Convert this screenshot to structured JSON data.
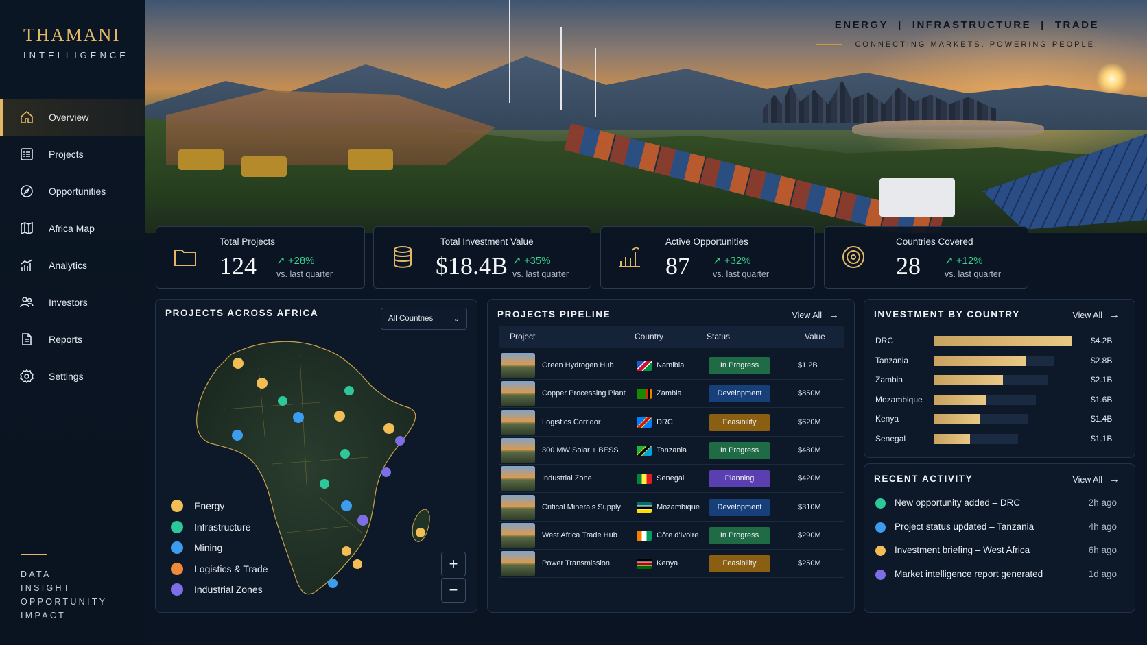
{
  "brand": {
    "name": "THAMANI",
    "sub": "INTELLIGENCE"
  },
  "nav": [
    {
      "label": "Overview",
      "icon": "home-icon"
    },
    {
      "label": "Projects",
      "icon": "list-icon"
    },
    {
      "label": "Opportunities",
      "icon": "compass-icon"
    },
    {
      "label": "Africa Map",
      "icon": "map-icon"
    },
    {
      "label": "Analytics",
      "icon": "chart-icon"
    },
    {
      "label": "Investors",
      "icon": "users-icon"
    },
    {
      "label": "Reports",
      "icon": "document-icon"
    },
    {
      "label": "Settings",
      "icon": "gear-icon"
    }
  ],
  "tagline": [
    "DATA",
    "INSIGHT",
    "OPPORTUNITY",
    "IMPACT"
  ],
  "topnav": {
    "links": [
      "ENERGY",
      "INFRASTRUCTURE",
      "TRADE"
    ],
    "separator": "|",
    "slogan": "CONNECTING MARKETS. POWERING PEOPLE."
  },
  "kpis": [
    {
      "label": "Total Projects",
      "value": "124",
      "delta": "↗ +28%",
      "sub": "vs. last quarter",
      "icon": "folder-icon"
    },
    {
      "label": "Total Investment Value",
      "value": "$18.4B",
      "delta": "↗ +35%",
      "sub": "vs. last quarter",
      "icon": "coins-icon"
    },
    {
      "label": "Active Opportunities",
      "value": "87",
      "delta": "↗ +32%",
      "sub": "vs. last quarter",
      "icon": "bar-chart-icon"
    },
    {
      "label": "Countries Covered",
      "value": "28",
      "delta": "↗ +12%",
      "sub": "vs. last quarter",
      "icon": "target-icon"
    }
  ],
  "map_panel": {
    "title": "PROJECTS ACROSS AFRICA",
    "filter": "All Countries",
    "legend": [
      {
        "label": "Energy",
        "color": "#f2bd55"
      },
      {
        "label": "Infrastructure",
        "color": "#2ec79a"
      },
      {
        "label": "Mining",
        "color": "#3b9cf0"
      },
      {
        "label": "Logistics & Trade",
        "color": "#f08a3a"
      },
      {
        "label": "Industrial Zones",
        "color": "#7d6ee6"
      }
    ],
    "zoom_in": "+",
    "zoom_out": "−"
  },
  "pipeline": {
    "title": "PROJECTS PIPELINE",
    "view_all": "View All",
    "columns": [
      "Project",
      "Country",
      "Status",
      "Value"
    ],
    "rows": [
      {
        "project": "Green Hydrogen Hub",
        "country": "Namibia",
        "status": "In Progress",
        "value": "$1.2B"
      },
      {
        "project": "Copper Processing Plant",
        "country": "Zambia",
        "status": "Development",
        "value": "$850M"
      },
      {
        "project": "Logistics Corridor",
        "country": "DRC",
        "status": "Feasibility",
        "value": "$620M"
      },
      {
        "project": "300 MW Solar + BESS",
        "country": "Tanzania",
        "status": "In Progress",
        "value": "$480M"
      },
      {
        "project": "Industrial Zone",
        "country": "Senegal",
        "status": "Planning",
        "value": "$420M"
      },
      {
        "project": "Critical Minerals Supply",
        "country": "Mozambique",
        "status": "Development",
        "value": "$310M"
      },
      {
        "project": "West Africa Trade Hub",
        "country": "Côte d'Ivoire",
        "status": "In Progress",
        "value": "$290M"
      },
      {
        "project": "Power Transmission",
        "country": "Kenya",
        "status": "Feasibility",
        "value": "$250M"
      }
    ],
    "status_colors": {
      "In Progress": "#1f6b46",
      "Development": "#17407a",
      "Feasibility": "#8a5f12",
      "Planning": "#5a3fb0"
    }
  },
  "investment": {
    "title": "INVESTMENT BY COUNTRY",
    "view_all": "View All",
    "rows": [
      {
        "country": "DRC",
        "amount": "$4.2B",
        "value": 4.2
      },
      {
        "country": "Tanzania",
        "amount": "$2.8B",
        "value": 2.8
      },
      {
        "country": "Zambia",
        "amount": "$2.1B",
        "value": 2.1
      },
      {
        "country": "Mozambique",
        "amount": "$1.6B",
        "value": 1.6
      },
      {
        "country": "Kenya",
        "amount": "$1.4B",
        "value": 1.4
      },
      {
        "country": "Senegal",
        "amount": "$1.1B",
        "value": 1.1
      }
    ]
  },
  "activity": {
    "title": "RECENT ACTIVITY",
    "view_all": "View All",
    "items": [
      {
        "text": "New opportunity added – DRC",
        "time": "2h ago",
        "color": "#2ec79a"
      },
      {
        "text": "Project status updated – Tanzania",
        "time": "4h ago",
        "color": "#3b9cf0"
      },
      {
        "text": "Investment briefing – West Africa",
        "time": "6h ago",
        "color": "#f2bd55"
      },
      {
        "text": "Market intelligence report generated",
        "time": "1d ago",
        "color": "#7d6ee6"
      }
    ]
  }
}
